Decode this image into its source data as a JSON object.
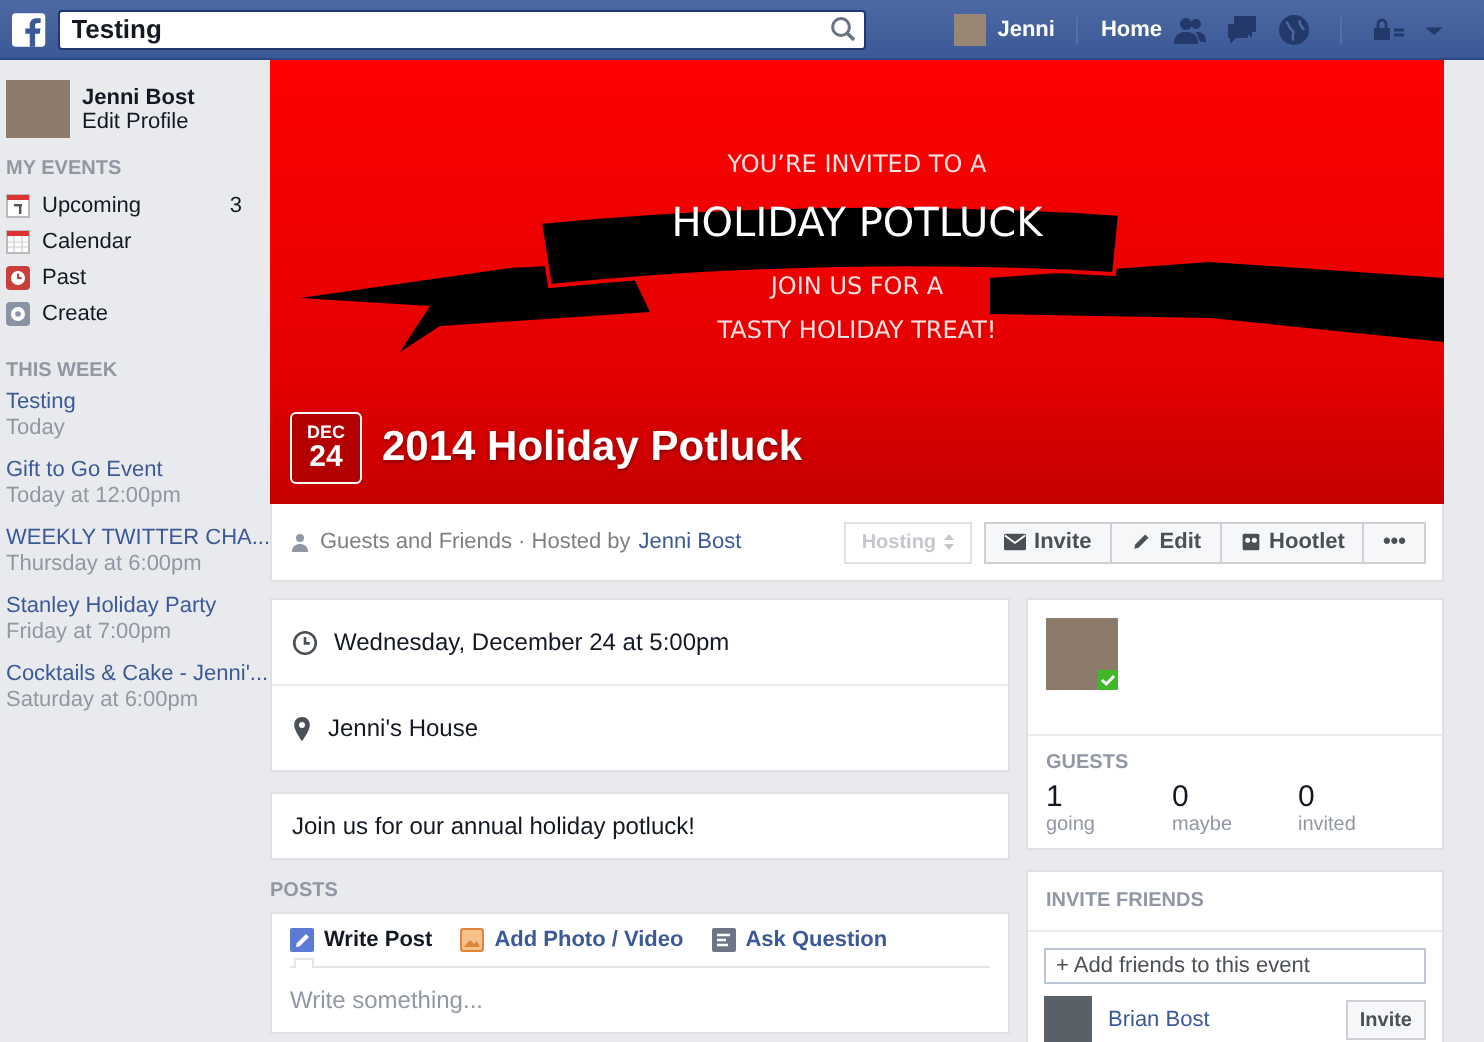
{
  "top_bar": {
    "search": {
      "value": "Testing"
    },
    "user_name": "Jenni",
    "nav_link": "Home"
  },
  "sidebar": {
    "profile": {
      "name": "Jenni Bost",
      "link": "Edit Profile"
    },
    "my_events": {
      "heading": "MY EVENTS",
      "items": [
        {
          "label": "Upcoming",
          "count": "3",
          "kind": "upcoming"
        },
        {
          "label": "Calendar",
          "kind": "calendar"
        },
        {
          "label": "Past",
          "kind": "past"
        },
        {
          "label": "Create",
          "kind": "create"
        }
      ]
    },
    "this_week": {
      "heading": "THIS WEEK",
      "events": [
        {
          "title": "Testing",
          "time": "Today"
        },
        {
          "title": "Gift to Go Event",
          "time": "Today at 12:00pm"
        },
        {
          "title": "WEEKLY TWITTER CHA...",
          "time": "Thursday at 6:00pm"
        },
        {
          "title": "Stanley Holiday Party",
          "time": "Friday at 7:00pm"
        },
        {
          "title": "Cocktails & Cake - Jenni'...",
          "time": "Saturday at 6:00pm"
        }
      ]
    }
  },
  "cover": {
    "lines": [
      "YOU’RE INVITED TO A",
      "HOLIDAY POTLUCK",
      "JOIN US FOR A",
      "TASTY HOLIDAY TREAT!"
    ],
    "date": {
      "month": "DEC",
      "day": "24"
    },
    "title": "2014 Holiday Potluck"
  },
  "event_bar": {
    "audience": "Guests and Friends · Hosted by",
    "host": "Jenni Bost",
    "rsvp": {
      "label": "Hosting",
      "disabled": true
    },
    "buttons": [
      {
        "label": "Invite",
        "kind": "invite"
      },
      {
        "label": "Edit",
        "kind": "edit"
      },
      {
        "label": "Hootlet",
        "kind": "hootlet"
      },
      {
        "label": "•••",
        "kind": "more"
      }
    ]
  },
  "details": [
    {
      "kind": "time",
      "text": "Wednesday, December 24 at 5:00pm"
    },
    {
      "kind": "place",
      "text": "Jenni's House"
    }
  ],
  "description": "Join us for our annual holiday potluck!",
  "posts": {
    "heading": "POSTS",
    "tabs": [
      {
        "label": "Write Post",
        "kind": "write",
        "selected": true
      },
      {
        "label": "Add Photo / Video",
        "kind": "photo",
        "selected": false
      },
      {
        "label": "Ask Question",
        "kind": "question",
        "selected": false
      }
    ],
    "placeholder": "Write something..."
  },
  "guests": {
    "heading": "GUESTS",
    "counts": [
      {
        "value": "1",
        "label": "going"
      },
      {
        "value": "0",
        "label": "maybe"
      },
      {
        "value": "0",
        "label": "invited"
      }
    ]
  },
  "invite_friends": {
    "heading": "INVITE FRIENDS",
    "placeholder": "+ Add friends to this event",
    "friends": [
      {
        "name": "Brian Bost",
        "button": "Invite"
      }
    ]
  }
}
